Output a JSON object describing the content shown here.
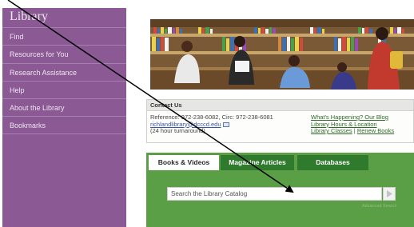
{
  "sidebar": {
    "title": "Library",
    "items": [
      {
        "label": "Find"
      },
      {
        "label": "Resources for You"
      },
      {
        "label": "Research Assistance"
      },
      {
        "label": "Help"
      },
      {
        "label": "About the Library"
      },
      {
        "label": "Bookmarks"
      }
    ]
  },
  "contact": {
    "heading": "Contact Us",
    "phone_line": "Reference: 972-238-6082, Circ: 972-238-6081",
    "email": "richlandlibrary@dcccd.edu",
    "hours_note": "(24 hour turnaround)",
    "links": [
      {
        "label": "What's Happening? Our Blog"
      },
      {
        "label": "Library Hours & Location"
      },
      {
        "label": "Library Classes"
      },
      {
        "label": "Renew Books"
      }
    ],
    "link_separator": " | "
  },
  "tabs": [
    {
      "label": "Books & Videos",
      "active": true
    },
    {
      "label": "Magazine Articles",
      "active": false
    },
    {
      "label": "Databases",
      "active": false
    }
  ],
  "search": {
    "placeholder": "Search the Library Catalog",
    "button_icon": "play-arrow-icon",
    "advanced_label": "Advanced Search"
  },
  "colors": {
    "sidebar_bg": "#8b5a94",
    "panel_green": "#5a9e45",
    "tab_inactive": "#2f7a2d",
    "link_green": "#2f6a2a"
  }
}
